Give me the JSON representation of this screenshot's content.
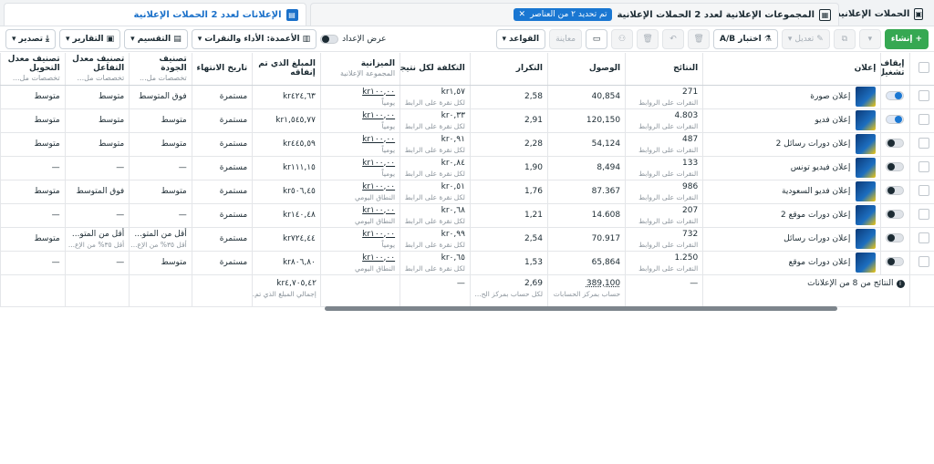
{
  "tabs": {
    "campaigns": "الحملات الإعلانية",
    "adsets": "المجموعات الإعلانية لعدد 2 الحملات الإعلانية",
    "selected_chip": "تم تحديد ٢ من العناصر",
    "ads": "الإعلانات لعدد 2 الحملات الإعلانية"
  },
  "toolbar": {
    "create": "إنشاء",
    "edit": "تعديل",
    "ab_test": "اختبار A/B",
    "preview": "معاينة",
    "rules": "القواعد",
    "view_setup": "عرض الإعداد",
    "columns": "الأعمدة: الأداء والنقرات",
    "breakdown": "التقسيم",
    "reports": "التقارير",
    "export": "تصدير"
  },
  "columns": {
    "toggle": "إيقاف/تشغيل",
    "ad": "إعلان",
    "results": "النتائج",
    "reach": "الوصول",
    "frequency": "التكرار",
    "cpr": "التكلفة لكل نتيجة",
    "budget": "الميزانية",
    "budget_sub": "المجموعة الإعلانية",
    "spent": "المبلغ الذي تم إنفاقه",
    "end": "تاريخ الانتهاء",
    "quality": "تصنيف الجودة",
    "quality_sub": "تخصصات مل...",
    "engagement": "تصنيف معدل التفاعل",
    "engagement_sub": "تخصصات مل...",
    "conversion": "تصنيف معدل التحويل",
    "conversion_sub": "تخصصات مل..."
  },
  "rows": [
    {
      "name": "إعلان صورة",
      "on": true,
      "results": "271",
      "results_sub": "النقرات على الروابط",
      "reach": "40,854",
      "freq": "2,58",
      "cpr": "kr١,٥٧",
      "cpr_sub": "لكل نقرة على الرابط",
      "budget": "kr١٠٠,٠٠",
      "budget_sub": "يومياً",
      "spent": "kr٤٢٤,٦٣",
      "end": "مستمرة",
      "quality": "فوق المتوسط",
      "engagement": "متوسط",
      "conversion": "متوسط"
    },
    {
      "name": "إعلان فديو",
      "on": true,
      "results": "4.803",
      "results_sub": "النقرات على الروابط",
      "reach": "120,150",
      "freq": "2,91",
      "cpr": "kr٠,٣٣",
      "cpr_sub": "لكل نقرة على الرابط",
      "budget": "kr١٠٠,٠٠",
      "budget_sub": "يومياً",
      "spent": "kr١,٥٤٥,٧٧",
      "end": "مستمرة",
      "quality": "متوسط",
      "engagement": "متوسط",
      "conversion": "متوسط"
    },
    {
      "name": "إعلان دورات رسائل 2",
      "on": false,
      "results": "487",
      "results_sub": "النقرات على الروابط",
      "reach": "54,124",
      "freq": "2,28",
      "cpr": "kr٠,٩١",
      "cpr_sub": "لكل نقرة على الرابط",
      "budget": "kr١٠٠,٠٠",
      "budget_sub": "يومياً",
      "spent": "kr٤٤٥,٥٩",
      "end": "مستمرة",
      "quality": "متوسط",
      "engagement": "متوسط",
      "conversion": "متوسط"
    },
    {
      "name": "إعلان فيديو تونس",
      "on": false,
      "results": "133",
      "results_sub": "النقرات على الروابط",
      "reach": "8,494",
      "freq": "1,90",
      "cpr": "kr٠,٨٤",
      "cpr_sub": "لكل نقرة على الرابط",
      "budget": "kr١٠٠,٠٠",
      "budget_sub": "يومياً",
      "spent": "kr١١١,١٥",
      "end": "مستمرة",
      "quality": "—",
      "engagement": "—",
      "conversion": "—"
    },
    {
      "name": "إعلان فديو السعودية",
      "on": false,
      "results": "986",
      "results_sub": "النقرات على الروابط",
      "reach": "87.367",
      "freq": "1,76",
      "cpr": "kr٠,٥١",
      "cpr_sub": "لكل نقرة على الرابط",
      "budget": "kr١٠٠,٠٠",
      "budget_sub": "النطاق اليومي",
      "spent": "kr٥٠٦,٤٥",
      "end": "مستمرة",
      "quality": "متوسط",
      "engagement": "فوق المتوسط",
      "conversion": "متوسط"
    },
    {
      "name": "إعلان دورات موقع 2",
      "on": false,
      "results": "207",
      "results_sub": "النقرات على الروابط",
      "reach": "14.608",
      "freq": "1,21",
      "cpr": "kr٠,٦٨",
      "cpr_sub": "لكل نقرة على الرابط",
      "budget": "kr١٠٠,٠٠",
      "budget_sub": "النطاق اليومي",
      "spent": "kr١٤٠,٤٨",
      "end": "مستمرة",
      "quality": "—",
      "engagement": "—",
      "conversion": "—"
    },
    {
      "name": "إعلان دورات رسائل",
      "on": false,
      "results": "732",
      "results_sub": "النقرات على الروابط",
      "reach": "70.917",
      "freq": "2,54",
      "cpr": "kr٠,٩٩",
      "cpr_sub": "لكل نقرة على الرابط",
      "budget": "kr١٠٠,٠٠",
      "budget_sub": "يومياً",
      "spent": "kr٧٢٤,٤٤",
      "end": "مستمرة",
      "quality": "أقل من المتو...",
      "quality_sub": "أقل ٣٥% من الإع...",
      "engagement": "أقل من المتو...",
      "engagement_sub": "أقل ٣٥% من الإع...",
      "conversion": "متوسط"
    },
    {
      "name": "إعلان دورات موقع",
      "on": false,
      "results": "1.250",
      "results_sub": "النقرات على الروابط",
      "reach": "65,864",
      "freq": "1,53",
      "cpr": "kr٠,٦٥",
      "cpr_sub": "لكل نقرة على الرابط",
      "budget": "kr١٠٠,٠٠",
      "budget_sub": "النطاق اليومي",
      "spent": "kr٨٠٦,٨٠",
      "end": "مستمرة",
      "quality": "متوسط",
      "engagement": "—",
      "conversion": "—"
    }
  ],
  "totals": {
    "label": "النتائج من 8 من الإعلانات",
    "results": "—",
    "reach": "389,100",
    "reach_sub": "حساب بمركز الحسابات",
    "freq": "2,69",
    "freq_sub": "لكل حساب بمركز الح...",
    "cpr": "—",
    "spent": "kr٤,٧٠٥,٤٢",
    "spent_sub": "إجمالي المبلغ الذي تم..."
  }
}
